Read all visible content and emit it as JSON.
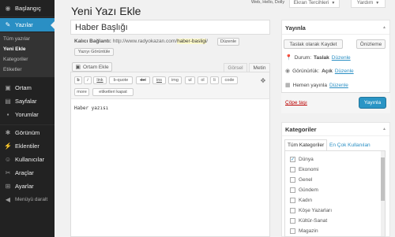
{
  "sidebar": {
    "items": [
      {
        "label": "Başlangıç",
        "icon": "dashboard-icon",
        "glyph": "◉"
      },
      {
        "label": "Yazılar",
        "icon": "pushpin-icon",
        "glyph": "✎"
      },
      {
        "label": "Ortam",
        "icon": "media-icon",
        "glyph": "▣"
      },
      {
        "label": "Sayfalar",
        "icon": "pages-icon",
        "glyph": "▤"
      },
      {
        "label": "Yorumlar",
        "icon": "comments-icon",
        "glyph": "▪"
      },
      {
        "label": "Görünüm",
        "icon": "appearance-icon",
        "glyph": "✱"
      },
      {
        "label": "Eklentiler",
        "icon": "plugins-icon",
        "glyph": "⚡"
      },
      {
        "label": "Kullanıcılar",
        "icon": "users-icon",
        "glyph": "☺"
      },
      {
        "label": "Araçlar",
        "icon": "tools-icon",
        "glyph": "✂"
      },
      {
        "label": "Ayarlar",
        "icon": "settings-icon",
        "glyph": "⊞"
      },
      {
        "label": "Menüyü daralt",
        "icon": "collapse-icon",
        "glyph": "◀"
      }
    ],
    "submenu": [
      "Tüm yazılar",
      "Yeni Ekle",
      "Kategoriler",
      "Etiketler"
    ]
  },
  "header": {
    "title": "Yeni Yazı Ekle",
    "user_greeting": "Web, Hello, Dolly",
    "screen_options": "Ekran Tercihleri",
    "help": "Yardım"
  },
  "post": {
    "title": "Haber Başlığı",
    "permalink_label": "Kalıcı Bağlantı:",
    "permalink_base": "http://www.radyokazan.com/",
    "permalink_slug": "haber-basligi",
    "permalink_tail": "/",
    "edit_button": "Düzenle",
    "view_button": "Yazıyı Görüntüle",
    "content": "Haber yazısı"
  },
  "editor": {
    "add_media": "Ortam Ekle",
    "tab_visual": "Görsel",
    "tab_text": "Metin",
    "quicktags": [
      "b",
      "i",
      "link",
      "b-quote",
      "del",
      "ins",
      "img",
      "ul",
      "ol",
      "li",
      "code",
      "more",
      "etiketleri kapat"
    ]
  },
  "publish": {
    "title": "Yayınla",
    "save_draft": "Taslak olarak Kaydet",
    "preview": "Önizleme",
    "status_label": "Durum:",
    "status_value": "Taslak",
    "visibility_label": "Görünürlük:",
    "visibility_value": "Açık",
    "schedule_label": "Hemen yayınla",
    "edit_link": "Düzenle",
    "trash": "Çöpe taşı",
    "publish_button": "Yayınla"
  },
  "categories": {
    "title": "Kategoriler",
    "tab_all": "Tüm Kategoriler",
    "tab_popular": "En Çok Kullanılan",
    "items": [
      {
        "label": "Dünya",
        "checked": "✓"
      },
      {
        "label": "Ekonomi",
        "checked": ""
      },
      {
        "label": "Genel",
        "checked": ""
      },
      {
        "label": "Gündem",
        "checked": ""
      },
      {
        "label": "Kadın",
        "checked": ""
      },
      {
        "label": "Köşe Yazarları",
        "checked": ""
      },
      {
        "label": "Kültür-Sanat",
        "checked": ""
      },
      {
        "label": "Magazin",
        "checked": ""
      }
    ]
  },
  "colors": {
    "sidebar_bg": "#222222",
    "active_menu": "#2a8fc4",
    "link": "#2a8fc4",
    "publish_button": "#2a95c5",
    "trash": "#bb0000"
  }
}
